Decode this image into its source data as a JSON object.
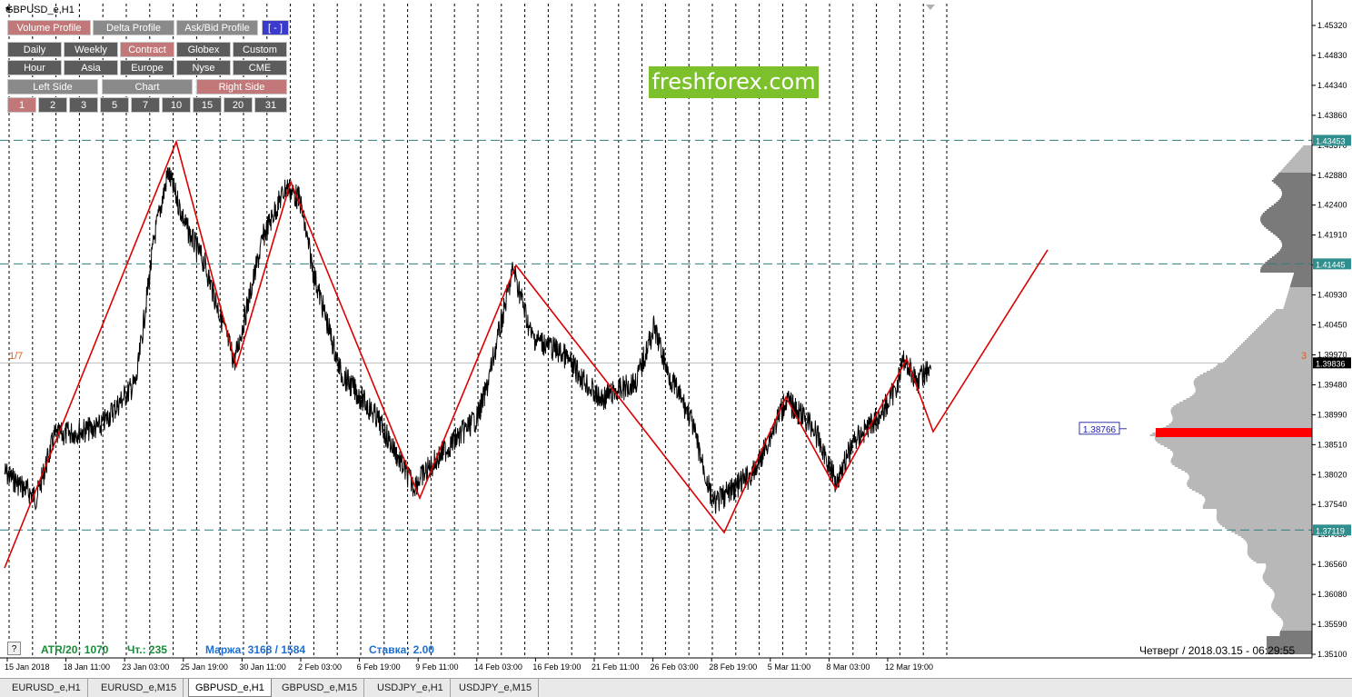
{
  "window": {
    "title": "GBPUSD_e,H1"
  },
  "buttons_row1": [
    {
      "label": "Volume Profile",
      "style": "red"
    },
    {
      "label": "Delta Profile",
      "style": "gray"
    },
    {
      "label": "Ask/Bid Profile",
      "style": "gray"
    },
    {
      "label": "[ - ]",
      "style": "blue"
    }
  ],
  "buttons_row2": [
    {
      "label": "Daily",
      "style": "dark"
    },
    {
      "label": "Weekly",
      "style": "dark"
    },
    {
      "label": "Contract",
      "style": "red"
    },
    {
      "label": "Globex",
      "style": "dark"
    },
    {
      "label": "Custom",
      "style": "dark"
    }
  ],
  "buttons_row3": [
    {
      "label": "Hour",
      "style": "dark"
    },
    {
      "label": "Asia",
      "style": "dark"
    },
    {
      "label": "Europe",
      "style": "dark"
    },
    {
      "label": "Nyse",
      "style": "dark"
    },
    {
      "label": "CME",
      "style": "dark"
    }
  ],
  "buttons_row4": [
    {
      "label": "Left Side",
      "style": "gray"
    },
    {
      "label": "Chart",
      "style": "gray"
    },
    {
      "label": "Right Side",
      "style": "red"
    }
  ],
  "buttons_row5": [
    {
      "label": "1",
      "style": "red"
    },
    {
      "label": "2",
      "style": "dark"
    },
    {
      "label": "3",
      "style": "dark"
    },
    {
      "label": "5",
      "style": "dark"
    },
    {
      "label": "7",
      "style": "dark"
    },
    {
      "label": "10",
      "style": "dark"
    },
    {
      "label": "15",
      "style": "dark"
    },
    {
      "label": "20",
      "style": "dark"
    },
    {
      "label": "31",
      "style": "dark"
    }
  ],
  "logo": {
    "text": "freshforex.com",
    "color": "#7cc02c"
  },
  "left_label": "1/7",
  "right_label": "3",
  "stats": {
    "atr": "ATR/20: 1070",
    "ch": "Чт.: 235",
    "margin": "Маржа: 3168 / 1584",
    "rate": "Ставка: 2.00"
  },
  "help_button": "?",
  "datetime": "Четверг  /  2018.03.15  -  06:29:55",
  "price_axis": {
    "ticks": [
      "1.45320",
      "1.44830",
      "1.44340",
      "1.43860",
      "1.43370",
      "1.42880",
      "1.42400",
      "1.41910",
      "1.41420",
      "1.40930",
      "1.40450",
      "1.39970",
      "1.39480",
      "1.38990",
      "1.38510",
      "1.38020",
      "1.37540",
      "1.37050",
      "1.36560",
      "1.36080",
      "1.35590",
      "1.35100"
    ],
    "levels": [
      "1.43453",
      "1.41445",
      "1.37119"
    ],
    "current": "1.39836",
    "poc": "1.38766"
  },
  "time_axis": [
    "15 Jan 2018",
    "18 Jan 11:00",
    "23 Jan 03:00",
    "25 Jan 19:00",
    "30 Jan 11:00",
    "2 Feb 03:00",
    "6 Feb 19:00",
    "9 Feb 11:00",
    "14 Feb 03:00",
    "16 Feb 19:00",
    "21 Feb 11:00",
    "26 Feb 03:00",
    "28 Feb 19:00",
    "5 Mar 11:00",
    "8 Mar 03:00",
    "12 Mar 19:00"
  ],
  "tabs": [
    {
      "label": "EURUSD_e,H1",
      "active": false
    },
    {
      "label": "EURUSD_e,M15",
      "active": false
    },
    {
      "label": "GBPUSD_e,H1",
      "active": true
    },
    {
      "label": "GBPUSD_e,M15",
      "active": false
    },
    {
      "label": "USDJPY_e,H1",
      "active": false
    },
    {
      "label": "USDJPY_e,M15",
      "active": false
    }
  ],
  "colors": {
    "zigzag": "#dd0000",
    "level_line": "#2f7f7f",
    "level_tag": "#2f8f8f",
    "profile": "#b8b8b8",
    "profile_dark": "#7a7a7a",
    "poc": "#ff0000",
    "price_tag": "#000000"
  }
}
